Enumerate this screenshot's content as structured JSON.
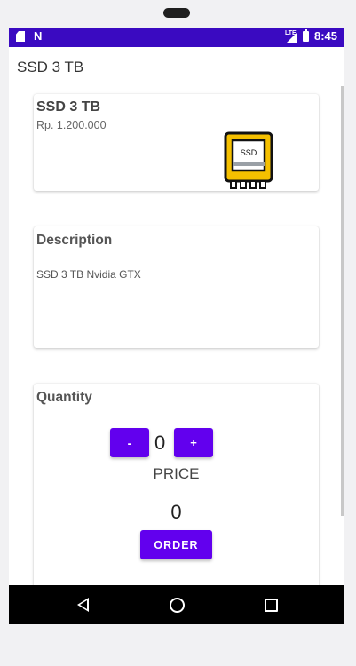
{
  "status_bar": {
    "time": "8:45",
    "network_label": "LTE",
    "icons": [
      "sd-card-icon",
      "n-notification-icon",
      "lte-signal-icon",
      "battery-charging-icon"
    ],
    "background_color": "#3a0ac1"
  },
  "app_bar": {
    "title": "SSD 3 TB"
  },
  "product_card": {
    "name": "SSD 3 TB",
    "price": "Rp. 1.200.000",
    "image_icon": "ssd-icon",
    "image_label": "SSD"
  },
  "description_card": {
    "heading": "Description",
    "text": "SSD 3 TB Nvidia GTX"
  },
  "quantity_card": {
    "heading": "Quantity",
    "decrement_label": "-",
    "increment_label": "+",
    "quantity": "0",
    "price_label": "PRICE",
    "price_value": "0",
    "order_label": "ORDER"
  },
  "colors": {
    "accent": "#6200ee",
    "ssd_icon_fill": "#f5c000"
  },
  "nav_bar": {
    "icons": [
      "back-icon",
      "home-icon",
      "recent-apps-icon"
    ]
  }
}
